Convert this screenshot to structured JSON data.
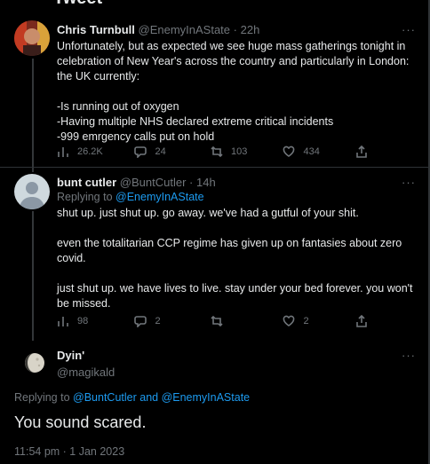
{
  "header": {
    "title": "Tweet"
  },
  "tweet1": {
    "name": "Chris Turnbull",
    "handle": "@EnemyInAState",
    "dot": "·",
    "time": "22h",
    "more": "···",
    "text_p1": "Unfortunately, but as expected we see huge mass gatherings tonight in celebration of New Year's across the country and particularly in London: the UK currently:",
    "text_l1": "-Is running out of oxygen",
    "text_l2": "-Having multiple NHS declared extreme critical incidents",
    "text_l3": "-999 emrgency calls put on hold",
    "stats": {
      "views": "26.2K",
      "replies": "24",
      "retweets": "103",
      "likes": "434"
    }
  },
  "tweet2": {
    "name": "bunt cutler",
    "handle": "@BuntCutler",
    "dot": "·",
    "time": "14h",
    "more": "···",
    "replying_prefix": "Replying to",
    "replying_to": "@EnemyInAState",
    "text_p1": "shut up. just shut up. go away. we've had a gutful of your shit.",
    "text_p2": "even the totalitarian CCP regime has given up on fantasies about zero covid.",
    "text_p3": "just shut up. we have lives to live. stay under your bed forever. you won't be missed.",
    "stats": {
      "views": "98",
      "replies": "2",
      "retweets": "",
      "likes": "2"
    }
  },
  "main": {
    "name": "Dyin'",
    "handle": "@magikald",
    "more": "···",
    "replying_prefix": "Replying to",
    "replying_to": "@BuntCutler and @EnemyInAState",
    "text": "You sound scared.",
    "timestamp": "11:54 pm · 1 Jan 2023"
  },
  "colors": {
    "background": "#000000",
    "accent": "#1d9bf0",
    "muted": "#71767b",
    "text": "#e7e9ea"
  }
}
